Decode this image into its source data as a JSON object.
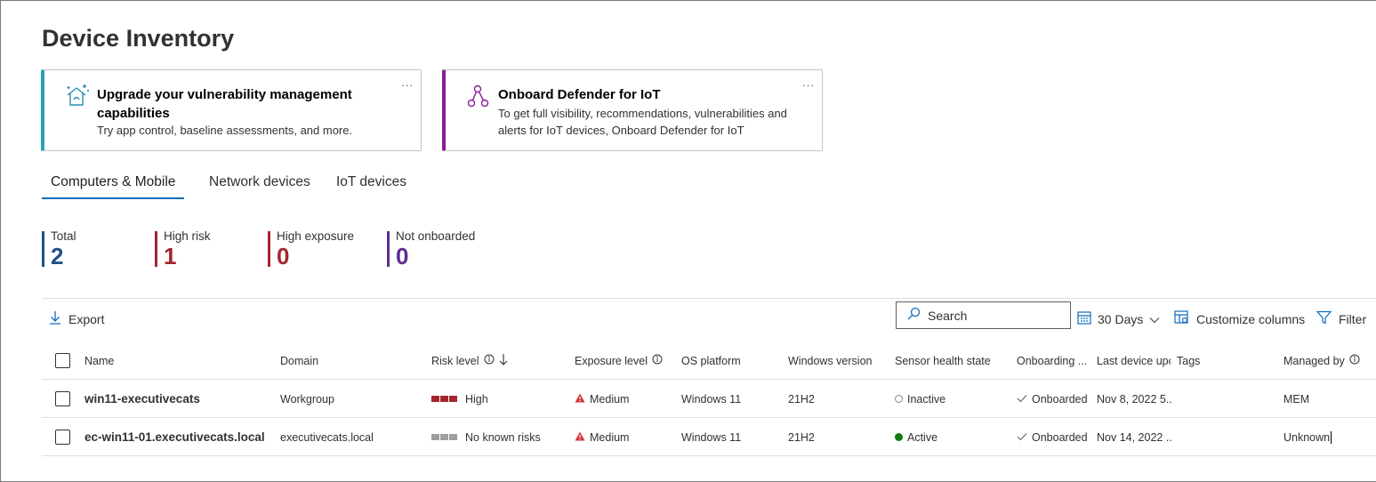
{
  "page": {
    "title": "Device Inventory"
  },
  "cards": [
    {
      "title": "Upgrade your vulnerability management capabilities",
      "description": "Try app control, baseline assessments, and more.",
      "more": "..."
    },
    {
      "title": "Onboard Defender for IoT",
      "description": "To get full visibility, recommendations, vulnerabilities and alerts for IoT devices, Onboard Defender for IoT",
      "more": "..."
    }
  ],
  "tabs": [
    "Computers & Mobile",
    "Network devices",
    "IoT devices"
  ],
  "active_tab": "Computers & Mobile",
  "stats": [
    {
      "label": "Total",
      "value": "2",
      "color": "#1f4e8c"
    },
    {
      "label": "High risk",
      "value": "1",
      "color": "#a4262c"
    },
    {
      "label": "High exposure",
      "value": "0",
      "color": "#a4262c"
    },
    {
      "label": "Not onboarded",
      "value": "0",
      "color": "#5c2e91"
    }
  ],
  "toolbar": {
    "export_label": "Export",
    "search_placeholder": "Search",
    "days_label": "30 Days",
    "customize_label": "Customize columns",
    "filter_label": "Filter"
  },
  "table": {
    "columns": {
      "name": "Name",
      "domain": "Domain",
      "risk": "Risk level",
      "exposure": "Exposure level",
      "os": "OS platform",
      "winver": "Windows version",
      "sensor": "Sensor health state",
      "onboarding": "Onboarding ...",
      "lastupdate": "Last device upc",
      "tags": "Tags",
      "managed": "Managed by"
    },
    "rows": [
      {
        "name": "win11-executivecats",
        "domain": "Workgroup",
        "risk": "High",
        "risk_color": "#a4262c",
        "exposure": "Medium",
        "os": "Windows 11",
        "winver": "21H2",
        "sensor": "Inactive",
        "onboarding": "Onboarded",
        "lastupdate": "Nov 8, 2022 5...",
        "tags": "",
        "managed": "MEM"
      },
      {
        "name": "ec-win11-01.executivecats.local",
        "domain": "executivecats.local",
        "risk": "No known risks",
        "risk_color": "#a19f9d",
        "exposure": "Medium",
        "os": "Windows 11",
        "winver": "21H2",
        "sensor": "Active",
        "onboarding": "Onboarded",
        "lastupdate": "Nov 14, 2022 ...",
        "tags": "",
        "managed": "Unknown"
      }
    ]
  }
}
